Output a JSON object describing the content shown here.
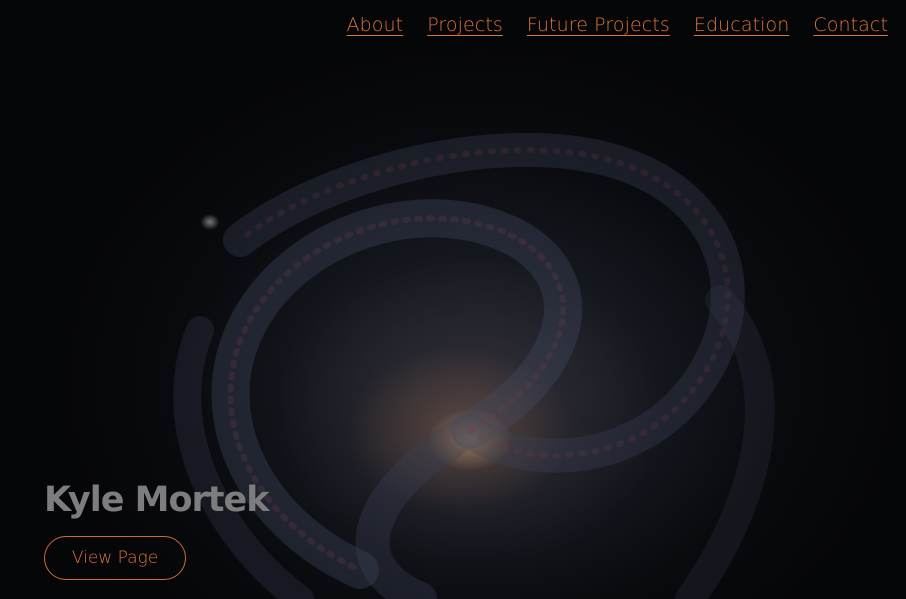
{
  "nav": {
    "items": [
      {
        "label": "About"
      },
      {
        "label": "Projects"
      },
      {
        "label": "Future Projects"
      },
      {
        "label": "Education"
      },
      {
        "label": "Contact"
      }
    ]
  },
  "hero": {
    "background": "spiral-galaxy-image",
    "name": "Kyle Mortek",
    "button_label": "View Page"
  },
  "colors": {
    "accent": "#e0733a",
    "name_text": "#7d7d7f",
    "background": "#050608"
  }
}
